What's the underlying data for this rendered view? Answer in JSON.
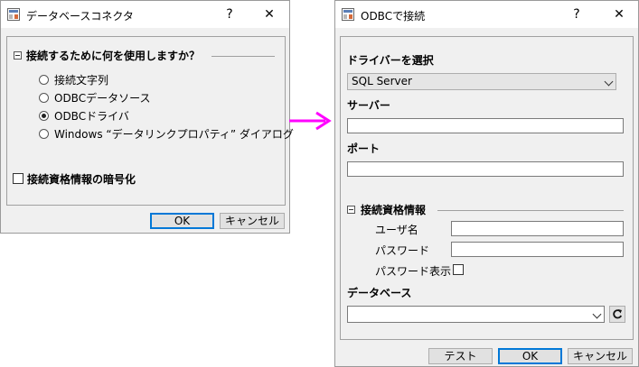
{
  "left_dialog": {
    "title": "データベースコネクタ",
    "help": "?",
    "close": "✕",
    "section_title": "接続するために何を使用しますか？",
    "options": [
      {
        "label": "接続文字列",
        "selected": false
      },
      {
        "label": "ODBCデータソース",
        "selected": false
      },
      {
        "label": "ODBCドライバ",
        "selected": true
      },
      {
        "label": "Windows “データリンクプロパティ” ダイアログ",
        "selected": false
      }
    ],
    "encrypt_label": "接続資格情報の暗号化",
    "ok": "OK",
    "cancel": "キャンセル"
  },
  "arrow": {
    "color": "#ff00ff"
  },
  "right_dialog": {
    "title": "ODBCで接続",
    "help": "?",
    "close": "✕",
    "driver_label": "ドライバーを選択",
    "driver_value": "SQL Server",
    "server_label": "サーバー",
    "server_value": "",
    "port_label": "ポート",
    "port_value": "",
    "cred_section": "接続資格情報",
    "username_label": "ユーザ名",
    "username_value": "",
    "password_label": "パスワード",
    "password_value": "",
    "show_password_label": "パスワード表示",
    "show_password_checked": false,
    "database_label": "データベース",
    "database_value": "",
    "test": "テスト",
    "ok": "OK",
    "cancel": "キャンセル"
  }
}
